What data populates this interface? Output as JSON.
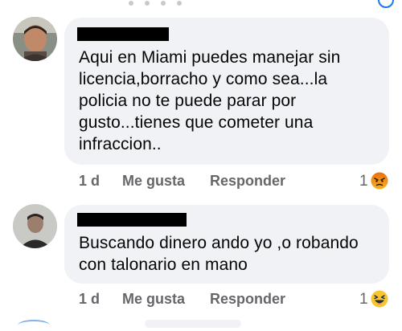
{
  "comments": [
    {
      "text": "Aqui en Miami puedes manejar sin\nlicencia,borracho y como sea...la\npolicia no te puede parar por\ngusto...tienes que cometer una\ninfraccion..",
      "time": "1 d",
      "like_label": "Me gusta",
      "reply_label": "Responder",
      "reaction_count": "1",
      "reaction_icon": "angry-face-icon"
    },
    {
      "text": "Buscando dinero ando yo ,o robando\ncon talonario en mano",
      "time": "1 d",
      "like_label": "Me gusta",
      "reply_label": "Responder",
      "reaction_count": "1",
      "reaction_icon": "laughing-face-icon"
    }
  ],
  "colors": {
    "bubble": "#f0f2f5",
    "action_text": "#65676b",
    "redaction": "#000000",
    "accent": "#1877f2"
  }
}
